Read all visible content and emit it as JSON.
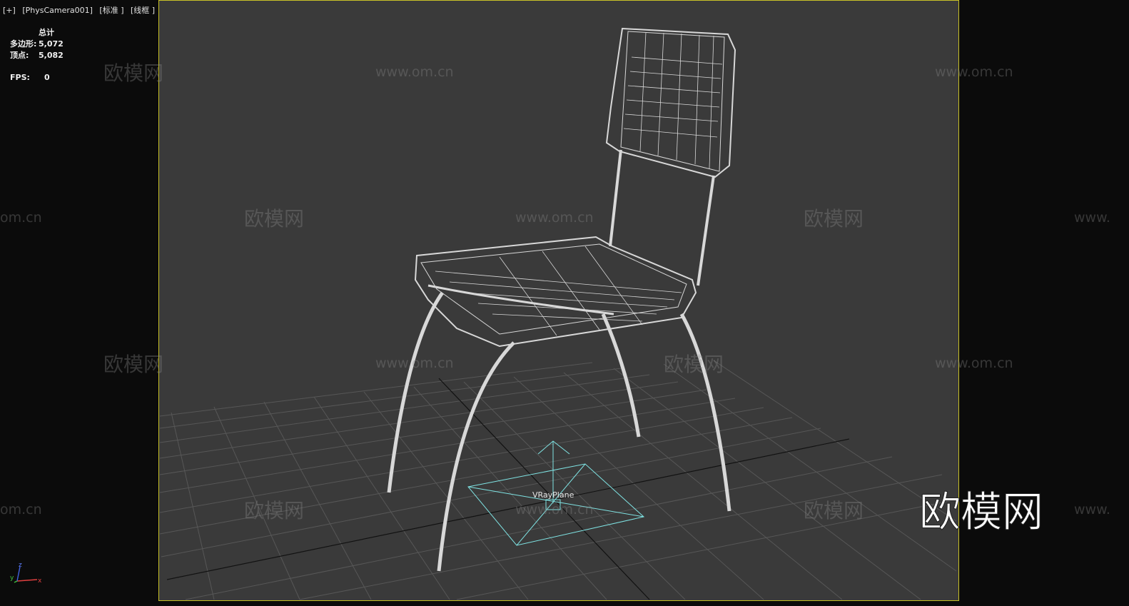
{
  "viewport": {
    "plus": "[+]",
    "camera": "[PhysCamera001]",
    "shading": "[标准 ]",
    "mode": "[线框 ]"
  },
  "stats": {
    "header": "总计",
    "polygons_label": "多边形:",
    "polygons_value": "5,072",
    "vertices_label": "顶点:",
    "vertices_value": "5,082",
    "fps_label": "FPS:",
    "fps_value": "0"
  },
  "scene": {
    "object_label": "VRayPlane",
    "wireframe_color": "#d8d8d8",
    "plane_color": "#7fe3e3",
    "grid_color": "#5a5a5a",
    "frame_color": "#c9c227"
  },
  "watermarks": {
    "url": "www.om.cn",
    "url_partial_left": "om.cn",
    "url_partial_right": "www.",
    "brand": "欧模网",
    "big_logo": "欧模网"
  },
  "gizmo": {
    "x": "x",
    "y": "y",
    "z": "z"
  }
}
